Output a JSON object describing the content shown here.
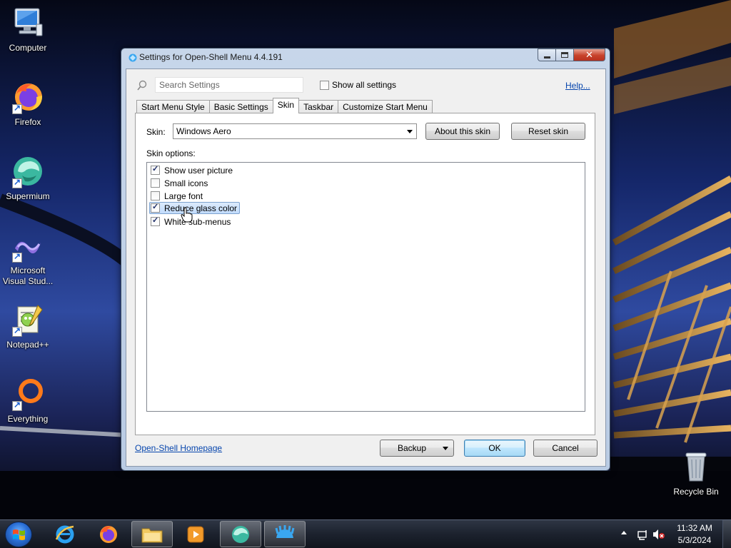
{
  "desktop": {
    "icons": [
      {
        "label": "Computer",
        "icon": "computer-icon"
      },
      {
        "label": "Firefox",
        "icon": "firefox-icon"
      },
      {
        "label": "Supermium",
        "icon": "supermium-icon"
      },
      {
        "label": "Microsoft Visual Stud...",
        "icon": "visual-studio-icon"
      },
      {
        "label": "Notepad++",
        "icon": "notepadpp-icon"
      },
      {
        "label": "Everything",
        "icon": "everything-icon"
      },
      {
        "label": "Recycle Bin",
        "icon": "recycle-bin-icon"
      }
    ]
  },
  "window": {
    "title": "Settings for Open-Shell Menu 4.4.191",
    "search_placeholder": "Search Settings",
    "show_all_label": "Show all settings",
    "show_all_checked": false,
    "help_label": "Help...",
    "tabs": [
      {
        "label": "Start Menu Style",
        "active": false
      },
      {
        "label": "Basic Settings",
        "active": false
      },
      {
        "label": "Skin",
        "active": true
      },
      {
        "label": "Taskbar",
        "active": false
      },
      {
        "label": "Customize Start Menu",
        "active": false
      }
    ],
    "skin": {
      "label": "Skin:",
      "selected": "Windows Aero",
      "about_button": "About this skin",
      "reset_button": "Reset skin"
    },
    "options_label": "Skin options:",
    "options": [
      {
        "label": "Show user picture",
        "checked": true,
        "selected": false
      },
      {
        "label": "Small icons",
        "checked": false,
        "selected": false
      },
      {
        "label": "Large font",
        "checked": false,
        "selected": false
      },
      {
        "label": "Reduce glass color",
        "checked": true,
        "selected": true
      },
      {
        "label": "White sub-menus",
        "checked": true,
        "selected": false
      }
    ],
    "homepage_link": "Open-Shell Homepage",
    "backup_button": "Backup",
    "ok_button": "OK",
    "cancel_button": "Cancel"
  },
  "taskbar": {
    "pinned": [
      "internet-explorer-icon",
      "firefox-icon",
      "file-explorer-icon",
      "media-player-icon",
      "supermium-icon",
      "open-shell-settings-icon"
    ],
    "clock_time": "11:32 AM",
    "clock_date": "5/3/2024"
  }
}
